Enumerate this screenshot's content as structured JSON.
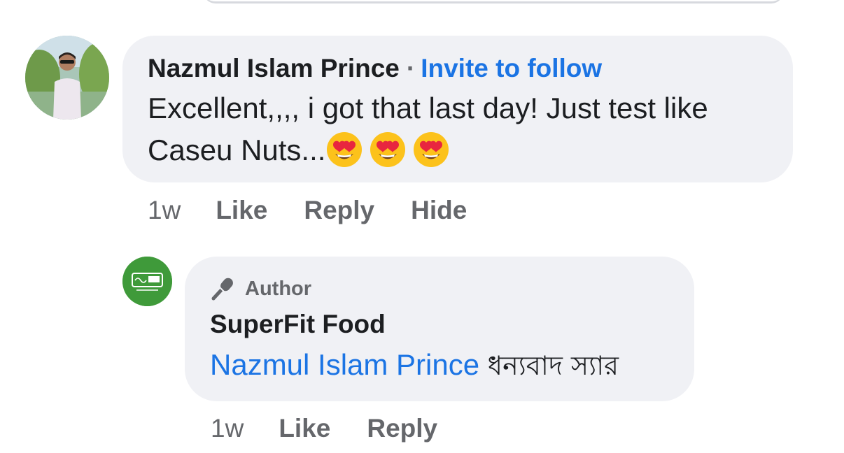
{
  "comment": {
    "author": "Nazmul Islam Prince",
    "separator": "·",
    "invite_link": "Invite to follow",
    "text": "Excellent,,,, i got that last day! Just test like Caseu Nuts...",
    "emoji_name": "heart-eyes-emoji",
    "emoji_count": 3,
    "time": "1w",
    "actions": {
      "like": "Like",
      "reply": "Reply",
      "hide": "Hide"
    }
  },
  "reply": {
    "badge_icon": "microphone-icon",
    "badge": "Author",
    "author": "SuperFit Food",
    "mention": "Nazmul Islam Prince",
    "text": "ধন্যবাদ স্যার",
    "time": "1w",
    "actions": {
      "like": "Like",
      "reply": "Reply"
    }
  },
  "colors": {
    "bubble": "#f0f1f5",
    "link": "#1b74e4",
    "text": "#1c1e21",
    "meta": "#65676b",
    "page_avatar": "#3f9a3a"
  }
}
